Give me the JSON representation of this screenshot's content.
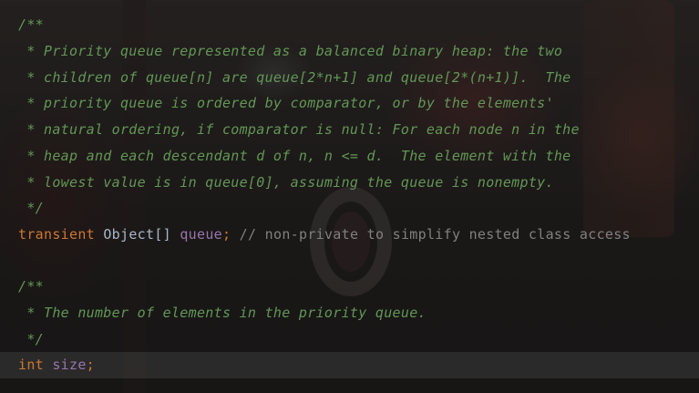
{
  "colors": {
    "doc_comment": "#629755",
    "keyword": "#cc7832",
    "type": "#a9b7c6",
    "field": "#9876aa",
    "line_comment": "#808080",
    "current_line": "rgba(255,255,255,0.085)"
  },
  "code": {
    "doc1": [
      "/**",
      " * Priority queue represented as a balanced binary heap: the two",
      " * children of queue[n] are queue[2*n+1] and queue[2*(n+1)].  The",
      " * priority queue is ordered by comparator, or by the elements'",
      " * natural ordering, if comparator is null: For each node n in the",
      " * heap and each descendant d of n, n <= d.  The element with the",
      " * lowest value is in queue[0], assuming the queue is nonempty.",
      " */"
    ],
    "decl1": {
      "keyword": "transient",
      "type": "Object[]",
      "field": "queue",
      "semicolon": ";",
      "comment": "// non-private to simplify nested class access"
    },
    "doc2": [
      "/**",
      " * The number of elements in the priority queue.",
      " */"
    ],
    "decl2": {
      "keyword": "int",
      "field": "size",
      "semicolon": ";"
    }
  }
}
